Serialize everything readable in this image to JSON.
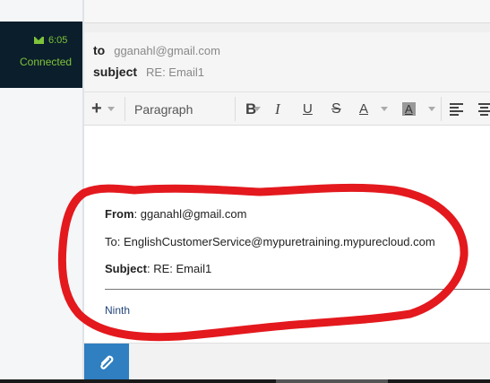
{
  "status": {
    "time": "6:05",
    "state": "Connected",
    "accent": "#7ec33a"
  },
  "header": {
    "to_label": "to",
    "to_value": "gganahl@gmail.com",
    "subject_label": "subject",
    "subject_value": "RE: Email1"
  },
  "toolbar": {
    "add_icon": "+",
    "paragraph_label": "Paragraph",
    "bold": "B",
    "italic": "I",
    "underline": "U",
    "strike": "S",
    "font_color": "A",
    "bg_color": "A"
  },
  "quoted": {
    "from_label": "From",
    "from_value": "gganahl@gmail.com",
    "to_label": "To",
    "to_value": "EnglishCustomerService@mypuretraining.mypurecloud.com",
    "subject_label": "Subject",
    "subject_value": "RE: Email1",
    "body": "Ninth"
  },
  "colors": {
    "attach_button": "#2f7fc1",
    "annotation": "#e3191e",
    "sidebar_panel": "#0b1e2b"
  }
}
